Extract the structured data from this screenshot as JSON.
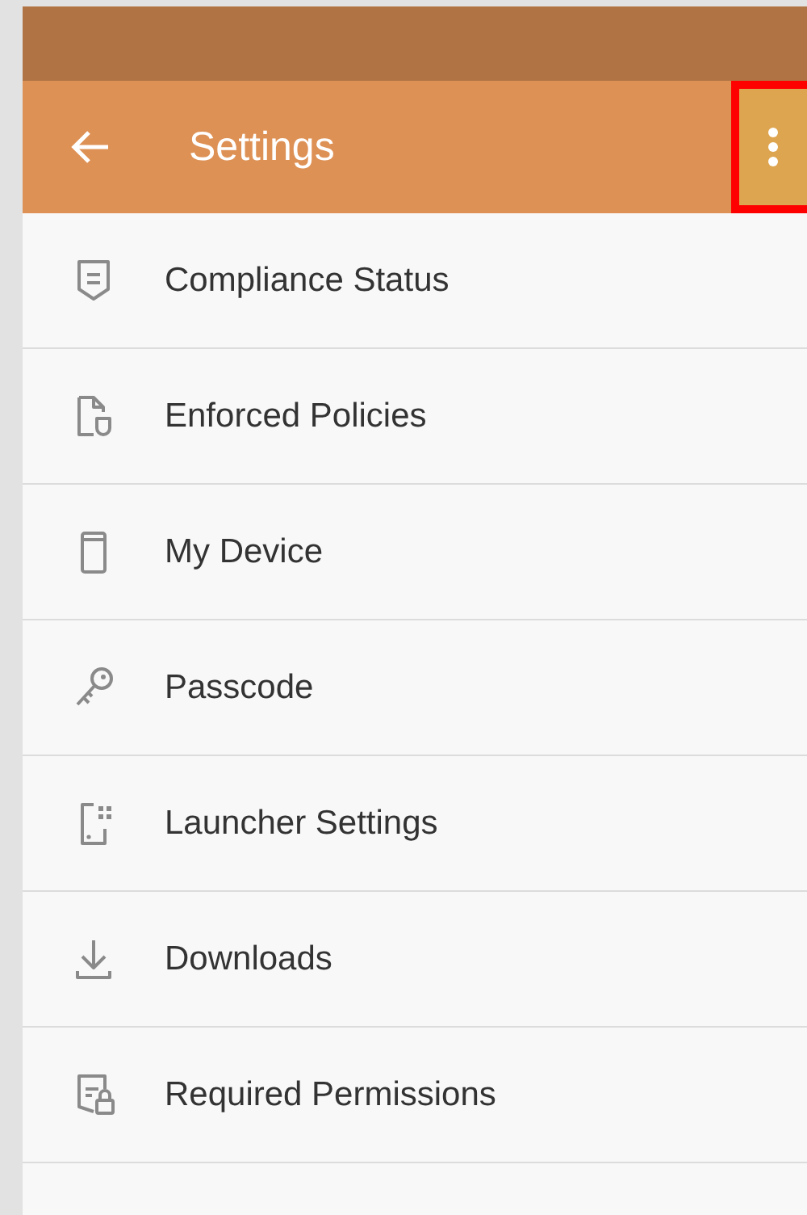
{
  "app_bar": {
    "title": "Settings",
    "more_button": {
      "highlighted": true
    }
  },
  "items": [
    {
      "label": "Compliance Status"
    },
    {
      "label": "Enforced Policies"
    },
    {
      "label": "My Device"
    },
    {
      "label": "Passcode"
    },
    {
      "label": "Launcher Settings"
    },
    {
      "label": "Downloads"
    },
    {
      "label": "Required Permissions"
    }
  ]
}
